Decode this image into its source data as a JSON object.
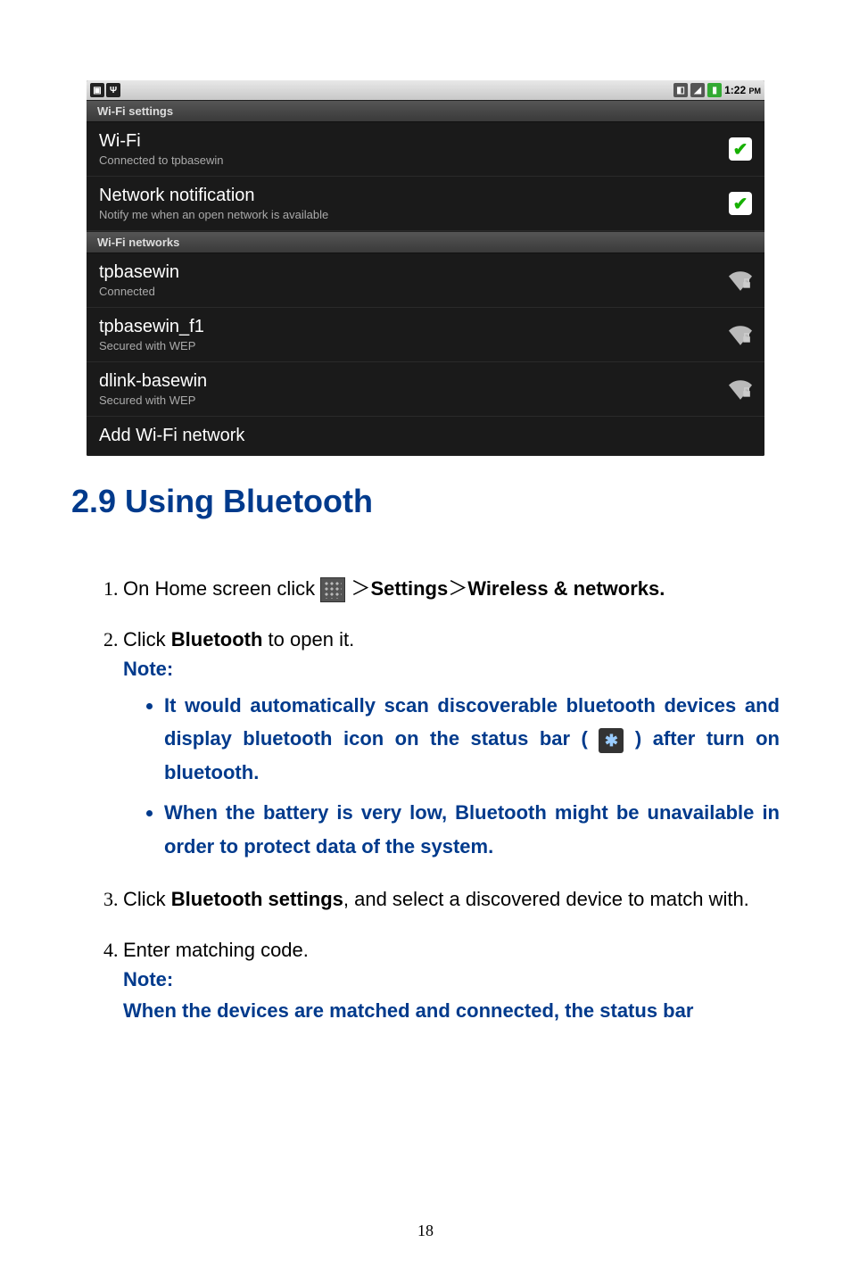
{
  "screenshot": {
    "clock": "1:22",
    "clock_ampm": "PM",
    "header1": "Wi-Fi settings",
    "row_wifi": {
      "title": "Wi-Fi",
      "sub": "Connected to tpbasewin"
    },
    "row_notif": {
      "title": "Network notification",
      "sub": "Notify me when an open network is available"
    },
    "header2": "Wi-Fi networks",
    "net1": {
      "title": "tpbasewin",
      "sub": "Connected"
    },
    "net2": {
      "title": "tpbasewin_f1",
      "sub": "Secured with WEP"
    },
    "net3": {
      "title": "dlink-basewin",
      "sub": "Secured with WEP"
    },
    "row_add": {
      "title": "Add Wi-Fi network"
    }
  },
  "headings": {
    "section": "2.9 Using Bluetooth"
  },
  "steps": {
    "s1_pre": "On Home screen click ",
    "s1_gt1": "＞",
    "s1_settings": "Settings",
    "s1_gt2": "＞",
    "s1_wireless": "Wireless & networks.",
    "s2_pre": "Click ",
    "s2_bt": "Bluetooth",
    "s2_post": " to open it.",
    "note_label": "Note:",
    "note1_a": "It would automatically scan discoverable bluetooth devices and display bluetooth icon on the status bar (",
    "note1_b": ") after turn on bluetooth.",
    "note2": "When the battery is very low, Bluetooth might be unavailable in order to protect data of the system.",
    "s3_pre": "Click ",
    "s3_bts": "Bluetooth settings",
    "s3_post": ", and select a discovered device to match with.",
    "s4": "Enter matching code.",
    "s4_note": "When the devices are matched and connected, the status bar"
  },
  "page_number": "18"
}
